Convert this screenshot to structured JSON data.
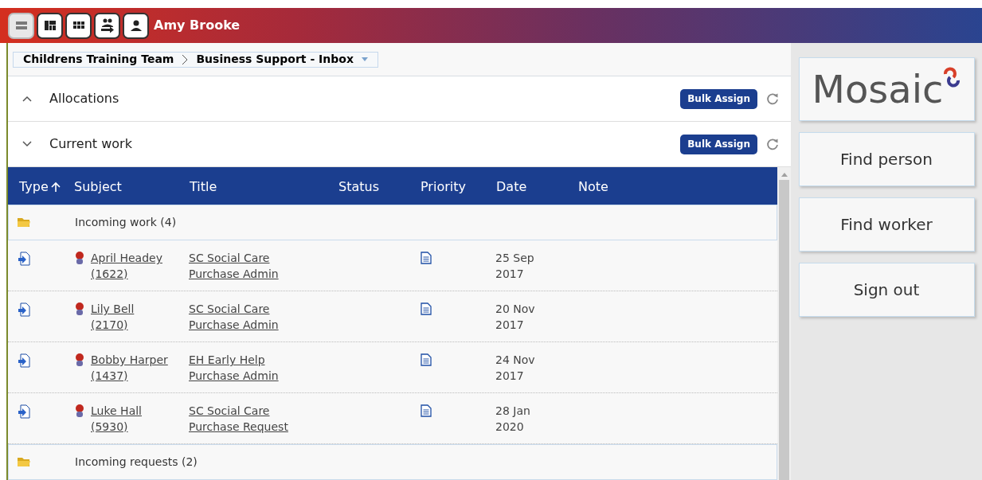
{
  "header": {
    "user_name": "Amy Brooke"
  },
  "breadcrumb": [
    "Childrens Training Team",
    "Business Support - Inbox"
  ],
  "sections": [
    {
      "title": "Allocations",
      "expanded": false,
      "button": "Bulk Assign"
    },
    {
      "title": "Current work",
      "expanded": true,
      "button": "Bulk Assign"
    }
  ],
  "table": {
    "columns": [
      {
        "label": "Type",
        "sorted": true
      },
      {
        "label": "Subject",
        "sorted": false
      },
      {
        "label": "Title",
        "sorted": false
      },
      {
        "label": "Status",
        "sorted": false
      },
      {
        "label": "Priority",
        "sorted": false
      },
      {
        "label": "Date",
        "sorted": false
      },
      {
        "label": "Note",
        "sorted": false
      }
    ],
    "rows": [
      {
        "kind": "group",
        "label": "Incoming work (4)"
      },
      {
        "kind": "item",
        "subject": [
          "April Headey",
          "(1622)"
        ],
        "title": [
          "SC Social Care",
          "Purchase Admin"
        ],
        "date": [
          "25 Sep",
          "2017"
        ]
      },
      {
        "kind": "item",
        "subject": [
          "Lily Bell",
          "(2170)"
        ],
        "title": [
          "SC Social Care",
          "Purchase Admin"
        ],
        "date": [
          "20 Nov",
          "2017"
        ]
      },
      {
        "kind": "item",
        "subject": [
          "Bobby Harper",
          "(1437)"
        ],
        "title": [
          "EH Early Help",
          "Purchase Admin"
        ],
        "date": [
          "24 Nov",
          "2017"
        ]
      },
      {
        "kind": "item",
        "subject": [
          "Luke Hall",
          "(5930)"
        ],
        "title": [
          "SC Social Care",
          "Purchase Request"
        ],
        "date": [
          "28 Jan",
          "2020"
        ]
      },
      {
        "kind": "group",
        "label": "Incoming requests (2)"
      }
    ]
  },
  "sidebar": {
    "logo": "Mosaic",
    "buttons": [
      "Find person",
      "Find worker",
      "Sign out"
    ]
  }
}
